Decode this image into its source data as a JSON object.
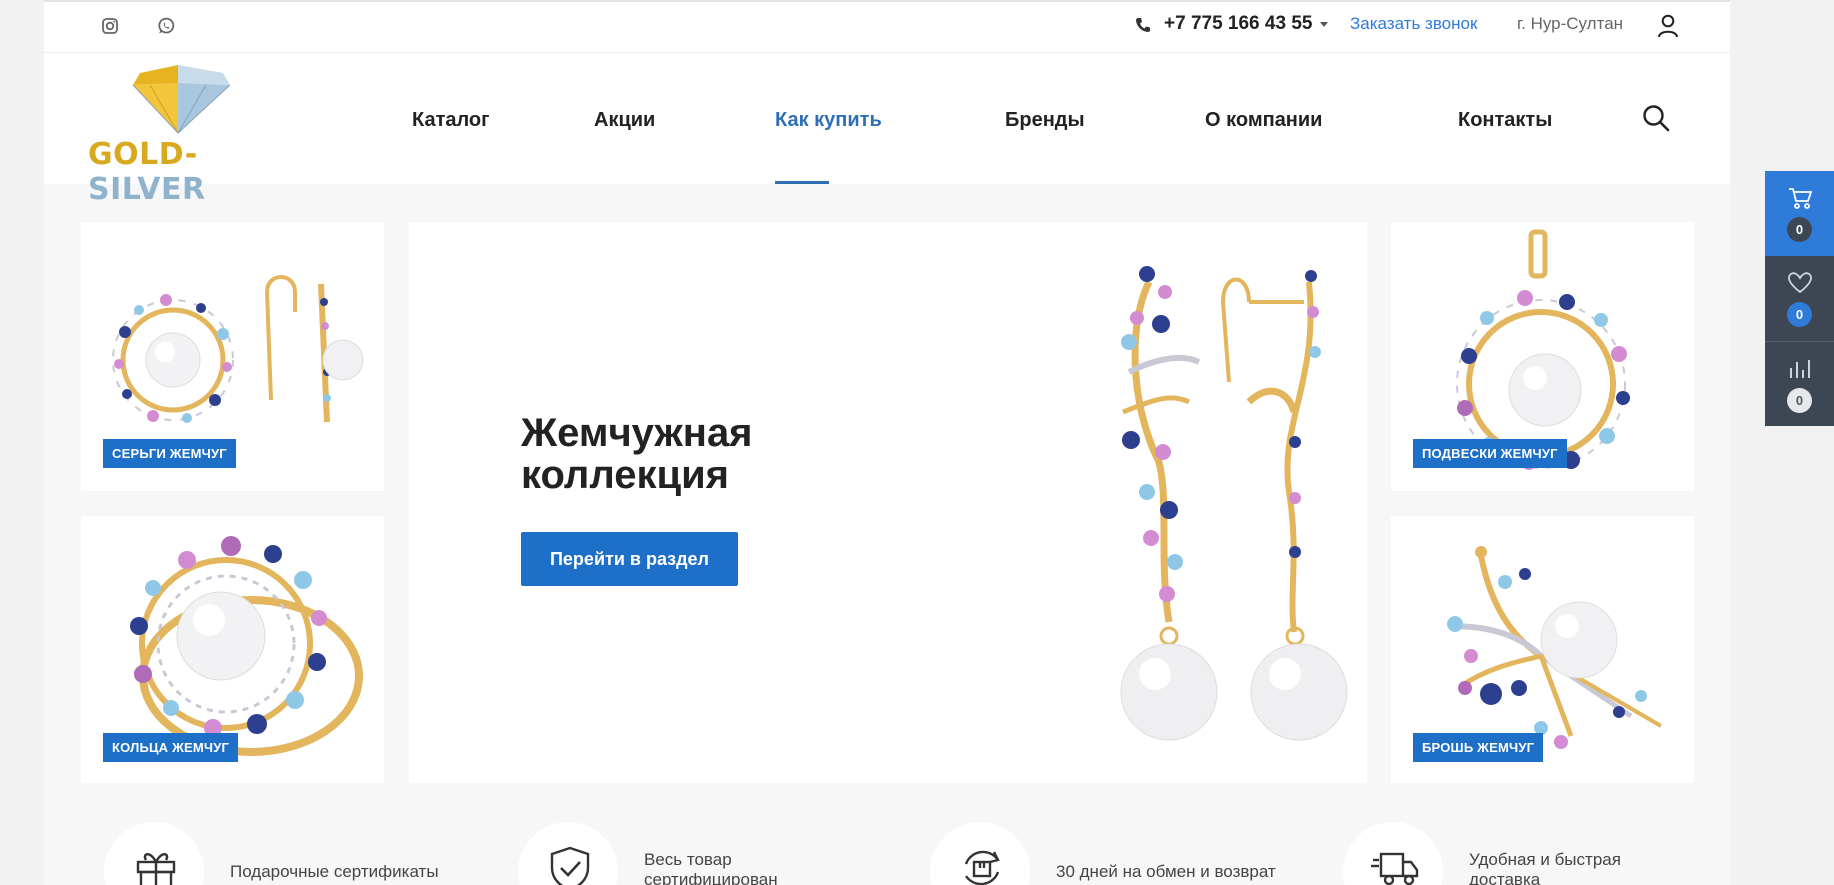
{
  "topbar": {
    "phone": "+7 775 166 43 55",
    "callback_label": "Заказать звонок",
    "city": "г. Нур-Султан"
  },
  "logo": {
    "text_gold": "GOLD",
    "text_dash": "-",
    "text_silver": "SILVER"
  },
  "nav": {
    "items": [
      {
        "label": "Каталог"
      },
      {
        "label": "Акции"
      },
      {
        "label": "Как купить",
        "active": true
      },
      {
        "label": "Бренды"
      },
      {
        "label": "О компании"
      },
      {
        "label": "Контакты"
      }
    ]
  },
  "tiles": {
    "earrings": "СЕРЬГИ ЖЕМЧУГ",
    "rings": "КОЛЬЦА ЖЕМЧУГ",
    "pendants": "ПОДВЕСКИ ЖЕМЧУГ",
    "brooch": "БРОШЬ ЖЕМЧУГ"
  },
  "banner": {
    "title_line1": "Жемчужная",
    "title_line2": "коллекция",
    "button": "Перейти в раздел"
  },
  "features": [
    {
      "line1": "Подарочные сертификаты",
      "line2": ""
    },
    {
      "line1": "Весь товар",
      "line2": "сертифицирован"
    },
    {
      "line1": "30 дней на обмен и возврат",
      "line2": ""
    },
    {
      "line1": "Удобная и быстрая",
      "line2": "доставка"
    }
  ],
  "side_panel": {
    "cart_count": "0",
    "favorites_count": "0",
    "compare_count": "0"
  },
  "colors": {
    "accent": "#1e6fc8",
    "link": "#2f7bd9",
    "nav_active": "#2f6fb6",
    "side_dark": "#3d4653"
  }
}
